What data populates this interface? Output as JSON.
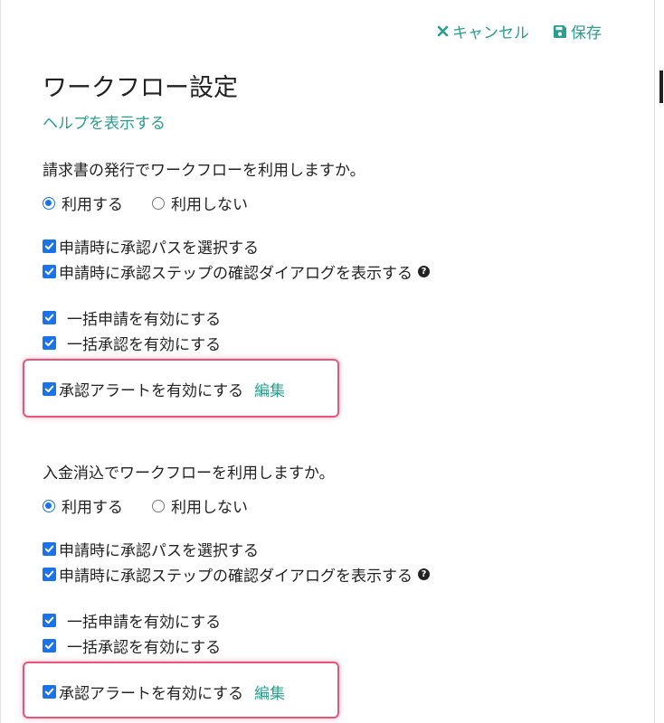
{
  "toolbar": {
    "cancel_label": "キャンセル",
    "save_label": "保存"
  },
  "page": {
    "title": "ワークフロー設定",
    "help_link": "ヘルプを表示する"
  },
  "sections": [
    {
      "question": "請求書の発行でワークフローを利用しますか。",
      "radio_options": [
        {
          "label": "利用する",
          "selected": true
        },
        {
          "label": "利用しない",
          "selected": false
        }
      ],
      "options": {
        "select_path": "申請時に承認パスを選択する",
        "confirm_dialog": "申請時に承認ステップの確認ダイアログを表示する",
        "bulk_apply": "一括申請を有効にする",
        "bulk_approve": "一括承認を有効にする",
        "alert": "承認アラートを有効にする",
        "alert_edit": "編集"
      }
    },
    {
      "question": "入金消込でワークフローを利用しますか。",
      "radio_options": [
        {
          "label": "利用する",
          "selected": true
        },
        {
          "label": "利用しない",
          "selected": false
        }
      ],
      "options": {
        "select_path": "申請時に承認パスを選択する",
        "confirm_dialog": "申請時に承認ステップの確認ダイアログを表示する",
        "bulk_apply": "一括申請を有効にする",
        "bulk_approve": "一括承認を有効にする",
        "alert": "承認アラートを有効にする",
        "alert_edit": "編集"
      }
    }
  ],
  "colors": {
    "accent": "#2a9d8f",
    "checkbox": "#1a73e8",
    "highlight": "#e8557a"
  },
  "icons": {
    "cancel": "close-icon",
    "save": "floppy-disk-icon",
    "help": "question-circle-icon"
  }
}
